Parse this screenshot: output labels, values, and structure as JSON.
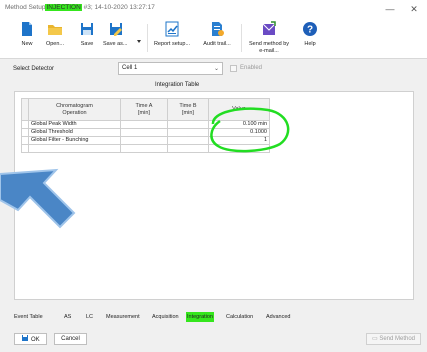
{
  "window": {
    "title_prefix": "Method Setup",
    "title_highlight": "INJECTION",
    "title_suffix": "#3; 14-10-2020 13:27:17",
    "minimize": "—",
    "close": "✕"
  },
  "toolbar": {
    "new": "New",
    "open": "Open...",
    "save": "Save",
    "save_as": "Save as...",
    "report_setup": "Report setup...",
    "audit_trail": "Audit trail...",
    "send_method_1": "Send method by",
    "send_method_2": "e-mail...",
    "help": "Help"
  },
  "detector": {
    "label": "Select Detector",
    "value": "Cell 1",
    "enabled_label": "Enabled",
    "enabled": false
  },
  "section": {
    "title": "Integration Table"
  },
  "table": {
    "headers": {
      "operation_1": "Chromatogram",
      "operation_2": "Operation",
      "timea_1": "Time A",
      "timea_2": "[min]",
      "timeb_1": "Time B",
      "timeb_2": "[min]",
      "value": "Value"
    },
    "rows": [
      {
        "operation": "Global Peak Width",
        "time_a": "",
        "time_b": "",
        "value": "0.100 min"
      },
      {
        "operation": "Global Threshold",
        "time_a": "",
        "time_b": "",
        "value": "0.1000"
      },
      {
        "operation": "Global Filter - Bunching",
        "time_a": "",
        "time_b": "",
        "value": "1"
      }
    ]
  },
  "tabs": [
    "Event Table",
    "AS",
    "LC",
    "Measurement",
    "Acquisition",
    "Integration",
    "Calculation",
    "Advanced"
  ],
  "active_tab": "Integration",
  "buttons": {
    "ok": "OK",
    "cancel": "Cancel",
    "send_method": "Send Method"
  },
  "colors": {
    "highlight": "#35e61d",
    "annotation": "#22dd22",
    "arrow": "#4a86c6"
  }
}
